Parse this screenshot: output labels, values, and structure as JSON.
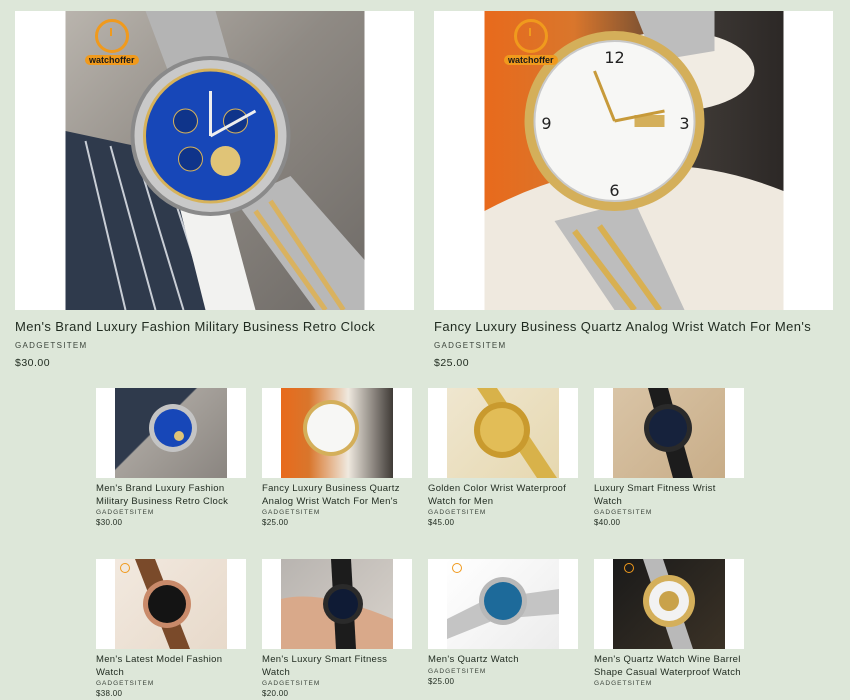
{
  "featured": [
    {
      "title": "Men's Brand Luxury Fashion Military Business Retro Clock",
      "vendor": "GADGETSITEM",
      "price": "$30.00",
      "logo_text": "watchoffer"
    },
    {
      "title": "Fancy Luxury Business Quartz Analog Wrist Watch For Men's",
      "vendor": "GADGETSITEM",
      "price": "$25.00",
      "logo_text": "watchoffer"
    }
  ],
  "grid": [
    {
      "title": "Men's Brand Luxury Fashion Military Business Retro Clock",
      "vendor": "GADGETSITEM",
      "price": "$30.00"
    },
    {
      "title": "Fancy Luxury Business Quartz Analog Wrist Watch For Men's",
      "vendor": "GADGETSITEM",
      "price": "$25.00"
    },
    {
      "title": "Golden Color Wrist Waterproof Watch for Men",
      "vendor": "GADGETSITEM",
      "price": "$45.00"
    },
    {
      "title": "Luxury Smart Fitness Wrist Watch",
      "vendor": "GADGETSITEM",
      "price": "$40.00"
    },
    {
      "title": "Men's Latest Model Fashion Watch",
      "vendor": "GADGETSITEM",
      "price": "$38.00"
    },
    {
      "title": "Men's Luxury Smart Fitness Watch",
      "vendor": "GADGETSITEM",
      "price": "$20.00"
    },
    {
      "title": "Men's Quartz Watch",
      "vendor": "GADGETSITEM",
      "price": "$25.00"
    },
    {
      "title": "Men's Quartz Watch Wine Barrel Shape Casual Waterproof Watch",
      "vendor": "GADGETSITEM",
      "price": ""
    }
  ],
  "colors": {
    "page_bg": "#dde7d9",
    "logo_orange": "#f09a1d",
    "text": "#1f2a1f"
  }
}
